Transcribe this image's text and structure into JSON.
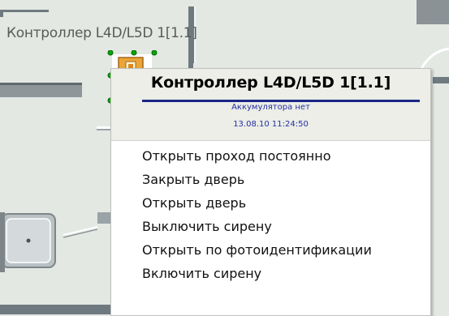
{
  "map": {
    "device_label": "Контроллер L4D/L5D 1[1.1]"
  },
  "context_menu": {
    "title": "Контроллер L4D/L5D 1[1.1]",
    "status": "Аккумулятора нет",
    "timestamp": "13.08.10 11:24:50",
    "items": [
      {
        "label": "Открыть проход постоянно"
      },
      {
        "label": "Закрыть дверь"
      },
      {
        "label": "Открыть дверь"
      },
      {
        "label": "Выключить сирену"
      },
      {
        "label": "Открыть по фотоидентификации"
      },
      {
        "label": "Включить сирену"
      }
    ]
  },
  "colors": {
    "floor": "#e3e8e3",
    "wall": "#6f7a80",
    "device_fill": "#e8a63a",
    "selection_handle": "#00aa00",
    "title_underline": "#1c2588",
    "status_text": "#242ea6"
  }
}
